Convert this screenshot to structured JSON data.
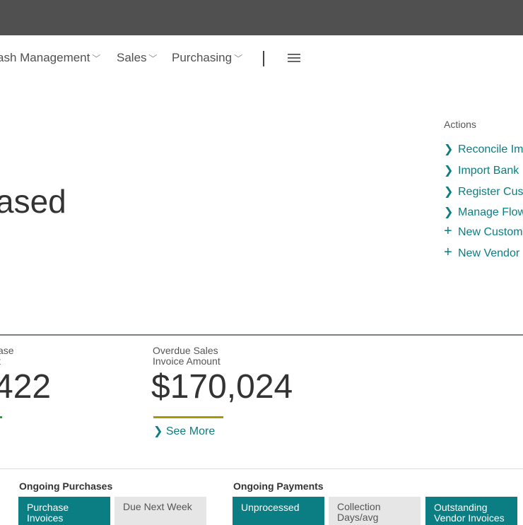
{
  "nav": {
    "items": [
      {
        "label": "ash Management"
      },
      {
        "label": "Sales"
      },
      {
        "label": "Purchasing"
      }
    ],
    "menu_icon": "hamburger-icon"
  },
  "heading": "ased",
  "actions": {
    "title": "Actions",
    "items": [
      {
        "icon": "chevron-right-icon",
        "label": "Reconcile Im"
      },
      {
        "icon": "chevron-right-icon",
        "label": "Import Bank"
      },
      {
        "icon": "chevron-right-icon",
        "label": "Register Cus"
      },
      {
        "icon": "chevron-right-icon",
        "label": "Manage Flow"
      },
      {
        "icon": "plus-icon",
        "label": "New Custom"
      },
      {
        "icon": "plus-icon",
        "label": "New Vendor"
      }
    ]
  },
  "kpis": [
    {
      "label": "ase\nt",
      "value": "422",
      "bar_color": "#2e9a3a"
    },
    {
      "label": "Overdue Sales\nInvoice Amount",
      "value": "$170,024",
      "bar_color": "#a59b00"
    }
  ],
  "see_more": "See More",
  "groups": [
    {
      "title": "Ongoing Purchases",
      "tiles": [
        {
          "label": "Purchase Invoices",
          "style": "teal"
        },
        {
          "label": "Due Next Week",
          "style": "gray"
        }
      ]
    },
    {
      "title": "Ongoing Payments",
      "tiles": [
        {
          "label": "Unprocessed",
          "style": "teal"
        },
        {
          "label": "Collection Days/avg",
          "style": "gray"
        },
        {
          "label": "Outstanding Vendor Invoices",
          "style": "teal"
        }
      ]
    }
  ],
  "colors": {
    "accent": "#0b7e84",
    "topbar": "#505050"
  }
}
